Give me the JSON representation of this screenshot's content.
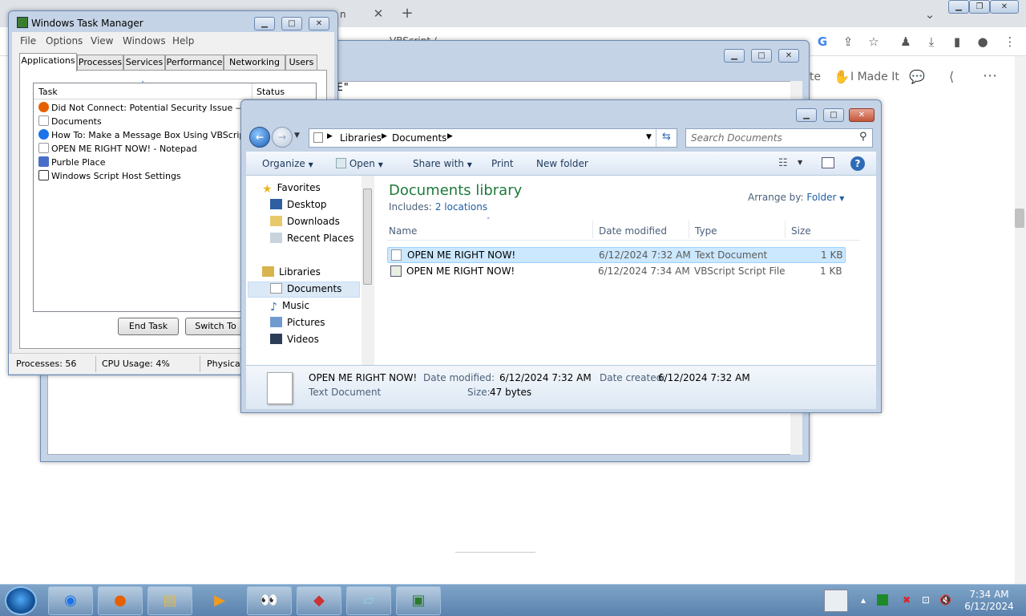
{
  "browser": {
    "tab_text": "n",
    "page_actions": [
      "ite",
      "I Made It"
    ],
    "partial_addr": "VBScript /"
  },
  "bgwin": {
    "fragment": "E\""
  },
  "task_manager": {
    "title": "Windows Task Manager",
    "menu": [
      "File",
      "Options",
      "View",
      "Windows",
      "Help"
    ],
    "tabs": [
      "Applications",
      "Processes",
      "Services",
      "Performance",
      "Networking",
      "Users"
    ],
    "columns": {
      "task": "Task",
      "status": "Status"
    },
    "tasks": [
      {
        "name": "Did Not Connect: Potential Security Issue — Moz...",
        "icon_color": "#e66000"
      },
      {
        "name": "Documents",
        "icon_color": "#ffffff"
      },
      {
        "name": "How To: Make a Message Box Using VBScript : 5 ...",
        "icon_color": "#1a73e8"
      },
      {
        "name": "OPEN ME RIGHT NOW! - Notepad",
        "icon_color": "#ffffff"
      },
      {
        "name": "Purble Place",
        "icon_color": "#4a6fc9"
      },
      {
        "name": "Windows Script Host Settings",
        "icon_color": "#ffffff"
      }
    ],
    "end_task": "End Task",
    "switch_to": "Switch To",
    "status": {
      "processes": "Processes: 56",
      "cpu": "CPU Usage: 4%",
      "physical": "Physical"
    }
  },
  "explorer": {
    "breadcrumb": [
      "Libraries",
      "Documents"
    ],
    "search_placeholder": "Search Documents",
    "commands": {
      "organize": "Organize",
      "open": "Open",
      "share": "Share with",
      "print": "Print",
      "new_folder": "New folder"
    },
    "nav": {
      "favorites": "Favorites",
      "desktop": "Desktop",
      "downloads": "Downloads",
      "recent": "Recent Places",
      "libraries": "Libraries",
      "documents": "Documents",
      "music": "Music",
      "pictures": "Pictures",
      "videos": "Videos"
    },
    "library_title": "Documents library",
    "includes_label": "Includes:",
    "includes_link": "2 locations",
    "arrange_label": "Arrange by:",
    "arrange_value": "Folder",
    "columns": {
      "name": "Name",
      "date": "Date modified",
      "type": "Type",
      "size": "Size"
    },
    "files": [
      {
        "name": "OPEN ME RIGHT NOW!",
        "date": "6/12/2024 7:32 AM",
        "type": "Text Document",
        "size": "1 KB"
      },
      {
        "name": "OPEN ME RIGHT NOW!",
        "date": "6/12/2024 7:34 AM",
        "type": "VBScript Script File",
        "size": "1 KB"
      }
    ],
    "details": {
      "name": "OPEN ME RIGHT NOW!",
      "modified_label": "Date modified:",
      "modified": "6/12/2024 7:32 AM",
      "created_label": "Date created:",
      "created": "6/12/2024 7:32 AM",
      "type": "Text Document",
      "size_label": "Size:",
      "size": "47 bytes"
    }
  },
  "taskbar": {
    "time": "7:34 AM",
    "date": "6/12/2024"
  },
  "colors": {
    "accent": "#1e5fa8",
    "library_title": "#1e7a3c",
    "selection": "#cce8ff"
  }
}
